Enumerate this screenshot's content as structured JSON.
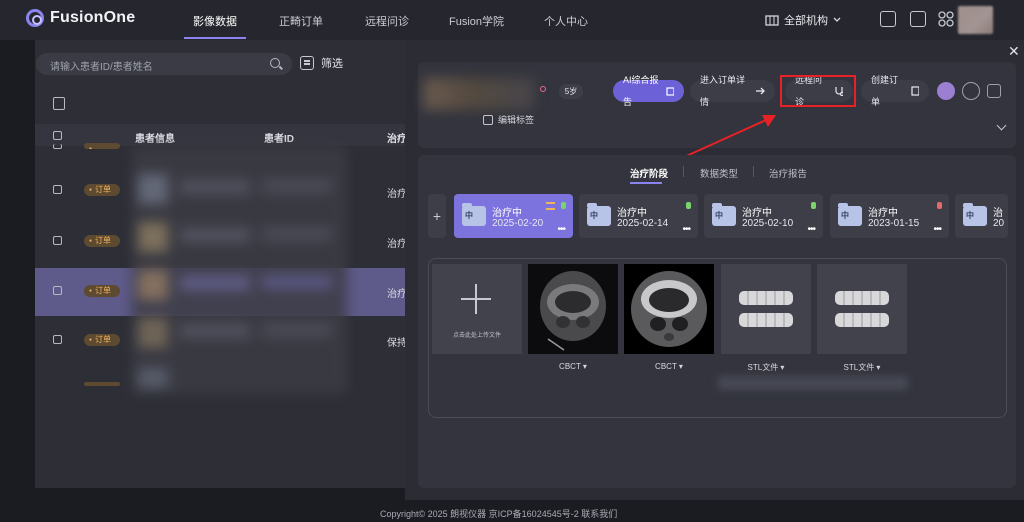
{
  "brand": {
    "name": "FusionOne",
    "accent": "#8b84f0"
  },
  "nav": {
    "items": [
      "影像数据",
      "正畸订单",
      "远程问诊",
      "Fusion学院",
      "个人中心"
    ],
    "active": "影像数据"
  },
  "org_selector": {
    "label": "全部机构"
  },
  "patient_list": {
    "search_placeholder": "请输入患者ID/患者姓名",
    "filter_label": "筛选",
    "columns": [
      "患者信息",
      "患者ID",
      "治疗"
    ],
    "rows": [
      {
        "badge": "订单",
        "status": "治疗"
      },
      {
        "badge": "订单",
        "status": "治疗"
      },
      {
        "badge": "订单",
        "status": "治疗",
        "selected": true
      },
      {
        "badge": "订单",
        "status": "保持"
      }
    ]
  },
  "patient_detail": {
    "age": "5岁",
    "edit_tag_label": "编辑标签",
    "actions": {
      "ai_report": "AI综合报告",
      "order_detail": "进入订单详情",
      "remote_consult": "远程问诊",
      "create_order": "创建订单"
    },
    "tabs": [
      "治疗阶段",
      "数据类型",
      "治疗报告"
    ],
    "active_tab": "治疗阶段",
    "stages": [
      {
        "title": "治疗中",
        "date": "2025-02-20",
        "icon_text": "中",
        "active": true
      },
      {
        "title": "治疗中",
        "date": "2025-02-14",
        "icon_text": "中"
      },
      {
        "title": "治疗中",
        "date": "2025-02-10",
        "icon_text": "中"
      },
      {
        "title": "治疗中",
        "date": "2023-01-15",
        "icon_text": "中"
      },
      {
        "title": "治",
        "date": "20",
        "icon_text": "中"
      }
    ],
    "upload_text": "点击此处上传文件",
    "files": [
      {
        "label": "CBCT"
      },
      {
        "label": "CBCT"
      },
      {
        "label": "STL文件"
      },
      {
        "label": "STL文件"
      }
    ]
  },
  "footer": {
    "text": "Copyright© 2025   朗视仪器   京ICP备16024545号-2     联系我们"
  }
}
